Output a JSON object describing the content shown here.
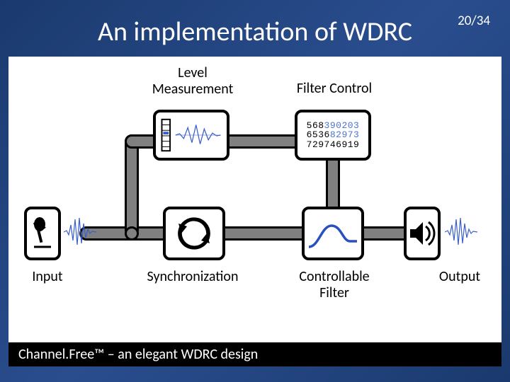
{
  "page_number": "20/34",
  "title": "An implementation of WDRC",
  "labels": {
    "level": "Level\nMeasurement",
    "filter_control": "Filter Control",
    "input": "Input",
    "sync": "Synchronization",
    "cfilter": "Controllable\nFilter",
    "output": "Output"
  },
  "filter_digits": {
    "row1": {
      "pre": "568",
      "hi": "390203",
      "post": ""
    },
    "row2": {
      "pre": "6536",
      "hi": "82973",
      "post": ""
    },
    "row3": {
      "pre": "729746919",
      "hi": "",
      "post": ""
    }
  },
  "footer": "Channel.Free™ – an elegant WDRC design"
}
